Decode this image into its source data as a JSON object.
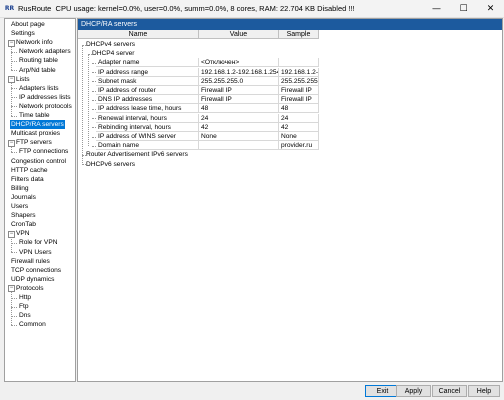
{
  "window": {
    "app_name": "RusRoute",
    "status": "CPU usage: kernel=0.0%, user=0.0%, summ=0.0%, 8 cores,  RAM: 22.704 KB Disabled !!!",
    "logo_text": "RR",
    "minimize_glyph": "—",
    "maximize_glyph": "☐",
    "close_glyph": "✕"
  },
  "tree": {
    "items": [
      "About page",
      "Settings",
      "Network info",
      "Network adapters",
      "Routing table",
      "Arp/Nd table",
      "Lists",
      "Adapters lists",
      "IP addresses lists",
      "Network protocols",
      "Time table",
      "DHCP/RA servers",
      "Multicast proxies",
      "FTP servers",
      "FTP connections",
      "Congestion control",
      "HTTP cache",
      "Filters data",
      "Billing",
      "Journals",
      "Users",
      "Shapers",
      "CronTab",
      "VPN",
      "Role for VPN",
      "VPN Users",
      "Firewall rules",
      "TCP connections",
      "UDP dynamics",
      "Protocols",
      "Http",
      "Ftp",
      "Dns",
      "Common"
    ],
    "selected": "DHCP/RA servers"
  },
  "panel": {
    "title": "DHCP/RA servers",
    "columns": {
      "name": "Name",
      "value": "Value",
      "sample": "Sample"
    },
    "groups": {
      "dhcpv4_servers": "DHCPv4 servers",
      "dhcpv4_server": "DHCP4 server",
      "router_adv": "Router Advertisement IPv6 servers",
      "dhcpv6_servers": "DHCPv6 servers"
    },
    "rows": [
      {
        "name": "Adapter name",
        "value": "<Отключен>",
        "sample": ""
      },
      {
        "name": "IP address range",
        "value": "192.168.1.2-192.168.1.254",
        "sample": "192.168.1.2-"
      },
      {
        "name": "Subnet mask",
        "value": "255.255.255.0",
        "sample": "255.255.255"
      },
      {
        "name": "IP address of router",
        "value": "Firewall IP",
        "sample": "Firewall IP"
      },
      {
        "name": "DNS IP addresses",
        "value": "Firewall IP",
        "sample": "Firewall IP"
      },
      {
        "name": "IP address lease time, hours",
        "value": "48",
        "sample": "48"
      },
      {
        "name": "Renewal interval, hours",
        "value": "24",
        "sample": "24"
      },
      {
        "name": "Rebinding interval, hours",
        "value": "42",
        "sample": "42"
      },
      {
        "name": "IP address of WINS server",
        "value": "None",
        "sample": "None"
      },
      {
        "name": "Domain name",
        "value": "",
        "sample": "provider.ru"
      }
    ]
  },
  "buttons": {
    "exit": "Exit",
    "apply": "Apply",
    "cancel": "Cancel",
    "help": "Help"
  }
}
